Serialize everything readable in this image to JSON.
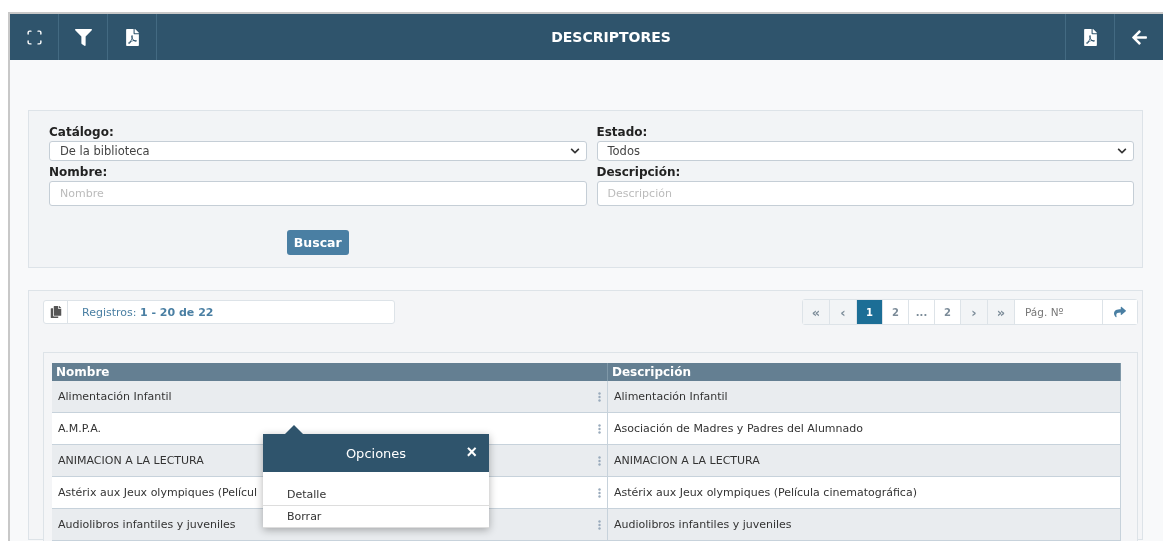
{
  "header": {
    "title": "DESCRIPTORES"
  },
  "filters": {
    "catalog": {
      "label": "Catálogo:",
      "value": "De la biblioteca"
    },
    "state": {
      "label": "Estado:",
      "value": "Todos"
    },
    "name": {
      "label": "Nombre:",
      "placeholder": "Nombre"
    },
    "description": {
      "label": "Descripción:",
      "placeholder": "Descripción"
    },
    "search_button": "Buscar"
  },
  "records": {
    "label": "Registros: **1 - 20 de 22**"
  },
  "pagination": {
    "items": [
      {
        "kind": "first",
        "label": "«",
        "selected": false
      },
      {
        "kind": "prev",
        "label": "‹",
        "selected": false
      },
      {
        "kind": "page",
        "label": "1",
        "selected": true
      },
      {
        "kind": "page",
        "label": "2",
        "selected": false
      },
      {
        "kind": "gap",
        "label": "...",
        "selected": false
      },
      {
        "kind": "page",
        "label": "2",
        "selected": false
      },
      {
        "kind": "next",
        "label": "›",
        "selected": false
      },
      {
        "kind": "last",
        "label": "»",
        "selected": false
      }
    ],
    "page_input": {
      "placeholder": "Pág. Nº"
    }
  },
  "table": {
    "columns": [
      "Nombre",
      "Descripción"
    ],
    "rows": [
      [
        "Alimentación Infantil",
        "Alimentación Infantil"
      ],
      [
        "A.M.P.A.",
        "Asociación de Madres y Padres del Alumnado"
      ],
      [
        "ANIMACION A LA LECTURA",
        "ANIMACION A LA LECTURA"
      ],
      [
        "Astérix aux Jeux olympiques (Películ",
        "Astérix aux Jeux olympiques (Película cinematográfica)"
      ],
      [
        "Audiolibros infantiles y juveniles",
        "Audiolibros infantiles y juveniles"
      ]
    ]
  },
  "popup": {
    "title": "Opciones",
    "close": "×",
    "items": [
      "Detalle",
      "Borrar"
    ]
  }
}
